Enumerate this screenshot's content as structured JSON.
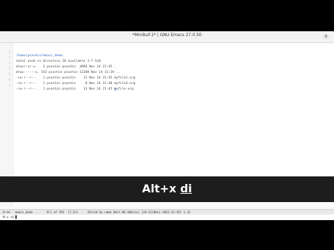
{
  "window": {
    "title": "*Minibuf-1* | GNU Emacs 27.0.50",
    "close_glyph": "×"
  },
  "buffer": {
    "lines": [
      {
        "num": "1",
        "text": "/home/psachin/emacs_demo:"
      },
      {
        "num": "2",
        "text": "total used in directory 20 available 3.7 GiB"
      },
      {
        "num": "3",
        "text": "drwxr-xr-x.   2 psachin psachin  4096 Nov 14 21:45 ."
      },
      {
        "num": "4",
        "text": "drwx------x. 153 psachin psachin 12288 Nov 14 21:29 .."
      },
      {
        "num": "5",
        "text": "-rw-r--r--.   1 psachin psachin    12 Nov 14 21:45 myfile1.org"
      },
      {
        "num": "6",
        "text": "-rw-r--r--.   1 psachin psachin     0 Nov 14 21:40 myfile3.org"
      },
      {
        "num": "7",
        "text_before": "-rw-r--r--.   1 psachin psachin    13 Nov 14 21:45 ",
        "text_cursor": "m",
        "text_after": "yfile.org"
      }
    ]
  },
  "modeline": {
    "text": "U:%%-  emacs_demo        All of 391  (7,53)     (Dired by name Umlt WS Abbrev) [24-11(Nov)-2022-21:45] 1.32"
  },
  "minibuffer": {
    "text": "M-x di"
  },
  "caption": {
    "prefix": "Alt+x ",
    "key": "di"
  }
}
